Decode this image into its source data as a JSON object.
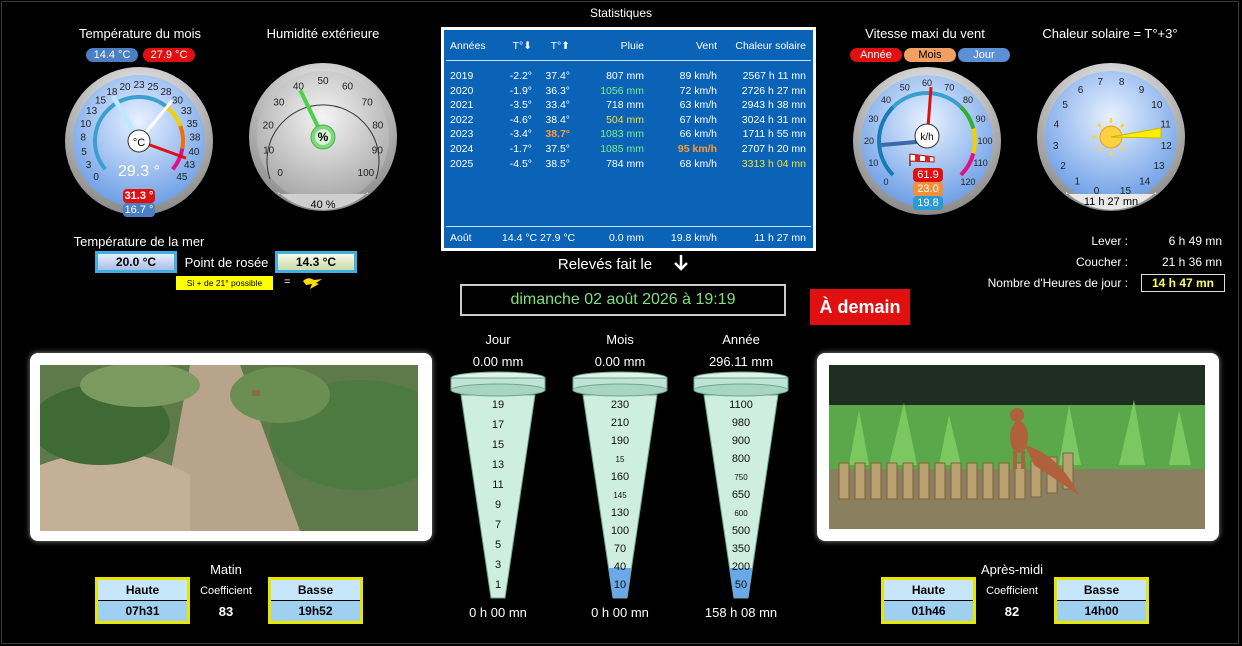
{
  "titles": {
    "temp_month": "Température du mois",
    "humidity": "Humidité extérieure",
    "stats": "Statistiques",
    "wind": "Vitesse maxi du vent",
    "solar": "Chaleur solaire = T°+3°",
    "sea": "Température de la mer",
    "dew": "Point de rosée",
    "reading": "Relevés fait le"
  },
  "temp_gauge": {
    "min_badge": "14.4 °C",
    "max_badge": "27.9 °C",
    "unit": "°C",
    "value": "29.3 °",
    "max_day": "31.3 °",
    "min_day": "16.7 °",
    "scale": [
      "0",
      "3",
      "5",
      "8",
      "10",
      "13",
      "15",
      "18",
      "20",
      "23",
      "25",
      "28",
      "30",
      "33",
      "35",
      "38",
      "40",
      "43",
      "45"
    ],
    "value_num": 29.3
  },
  "hum_gauge": {
    "unit": "%",
    "value": "40 %",
    "value_num": 40,
    "scale": [
      "0",
      "10",
      "20",
      "30",
      "40",
      "50",
      "60",
      "70",
      "80",
      "90",
      "100"
    ]
  },
  "stats": {
    "headers": [
      "Années",
      "T°⬇",
      "T°⬆",
      "Pluie",
      "Vent",
      "Chaleur solaire"
    ],
    "rows": [
      [
        "2019",
        "-2.2°",
        "37.4°",
        "807 mm",
        "89 km/h",
        "2567 h 11 mn"
      ],
      [
        "2020",
        "-1.9°",
        "36.3°",
        "1056 mm",
        "72 km/h",
        "2726 h 27 mn"
      ],
      [
        "2021",
        "-3.5°",
        "33.4°",
        "718 mm",
        "63 km/h",
        "2943 h 38 mn"
      ],
      [
        "2022",
        "-4.6°",
        "38.4°",
        "504 mm",
        "67 km/h",
        "3024 h 31 mn"
      ],
      [
        "2023",
        "-3.4°",
        "38.7°",
        "1083 mm",
        "66 km/h",
        "1711  h 55 mn"
      ],
      [
        "2024",
        "-1.7°",
        "37.5°",
        "1085 mm",
        "95 km/h",
        "2707 h 20 mn"
      ],
      [
        "2025",
        "-4.5°",
        "38.5°",
        "784 mm",
        "68 km/h",
        "3313 h 04 mn"
      ]
    ],
    "footer": [
      "Août",
      "14.4 °C",
      "27.9 °C",
      "0.0 mm",
      "19.8 km/h",
      "11 h 27 mn"
    ],
    "colors": {
      "green": "#7cf07c",
      "yellow": "#f0e030",
      "orange": "#ff9a30",
      "white": "#ffffff"
    }
  },
  "wind_gauge": {
    "tabs": [
      "Année",
      "Mois",
      "Jour"
    ],
    "unit": "k/h",
    "val_red": "61.9",
    "val_orange": "23.0",
    "val_blue": "19.8",
    "scale": [
      "0",
      "10",
      "20",
      "30",
      "40",
      "50",
      "60",
      "70",
      "80",
      "90",
      "100",
      "110",
      "120"
    ],
    "value_num": 61.9
  },
  "solar_gauge": {
    "value": "11 h 27 mn",
    "scale": [
      "0",
      "1",
      "2",
      "3",
      "4",
      "5",
      "6",
      "7",
      "8",
      "9",
      "10",
      "11",
      "12",
      "13",
      "14",
      "15"
    ]
  },
  "sea": {
    "value": "20.0 °C"
  },
  "dew": {
    "value": "14.3 °C",
    "note": "Si + de 21° possible",
    "eq": "="
  },
  "sun": {
    "rise_label": "Lever :",
    "rise": "6 h 49 mn",
    "set_label": "Coucher :",
    "set": "21 h 36 mn",
    "hours_label": "Nombre d'Heures de jour :",
    "hours": "14 h 47 mn"
  },
  "datetime": "dimanche 02 août 2026 à 19:19",
  "tomorrow_button": "À demain",
  "rain": [
    {
      "label": "Jour",
      "value": "0.00 mm",
      "time": "0 h 00 mn",
      "scale": [
        "19",
        "17",
        "15",
        "13",
        "11",
        "9",
        "7",
        "5",
        "3",
        "1"
      ],
      "fill": 0.0
    },
    {
      "label": "Mois",
      "value": "0.00 mm",
      "time": "0 h 00 mn",
      "scale": [
        "230",
        "210",
        "190",
        "15",
        "160",
        "145",
        "130",
        "100",
        "70",
        "40",
        "10"
      ],
      "fill": 0.15
    },
    {
      "label": "Année",
      "value": "296.11 mm",
      "time": "158 h 08 mn",
      "scale": [
        "1100",
        "980",
        "900",
        "800",
        "750",
        "650",
        "600",
        "500",
        "350",
        "200",
        "50"
      ],
      "fill": 0.15
    }
  ],
  "morning": {
    "title": "Matin",
    "high_label": "Haute",
    "high": "07h31",
    "coef_label": "Coefficient",
    "coef": "83",
    "low_label": "Basse",
    "low": "19h52"
  },
  "afternoon": {
    "title": "Après-midi",
    "high_label": "Haute",
    "high": "01h46",
    "coef_label": "Coefficient",
    "coef": "82",
    "low_label": "Basse",
    "low": "14h00"
  }
}
